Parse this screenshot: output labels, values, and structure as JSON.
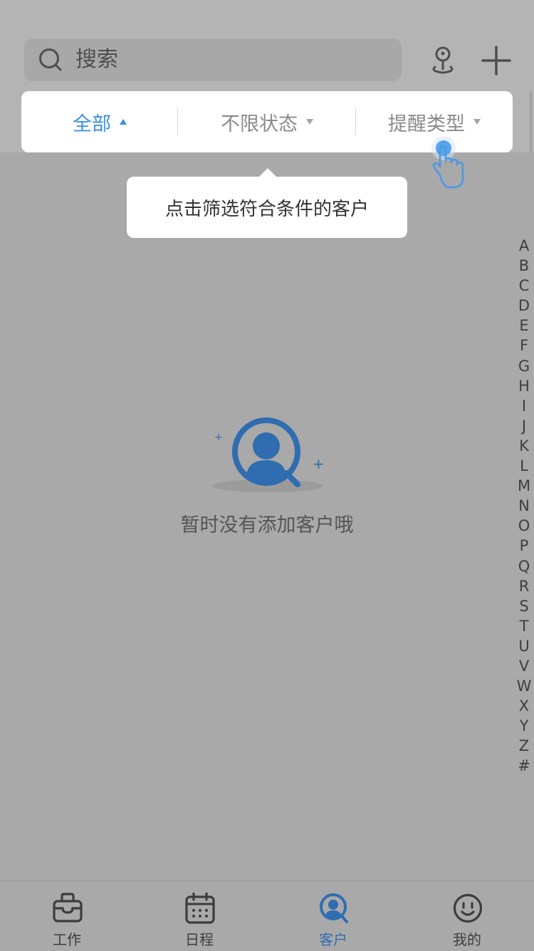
{
  "search": {
    "placeholder": "搜索"
  },
  "filters": [
    {
      "label": "全部",
      "active": true
    },
    {
      "label": "不限状态",
      "active": false
    },
    {
      "label": "提醒类型",
      "active": false
    }
  ],
  "tooltip": {
    "text": "点击筛选符合条件的客户"
  },
  "alphabet_index": [
    "A",
    "B",
    "C",
    "D",
    "E",
    "F",
    "G",
    "H",
    "I",
    "J",
    "K",
    "L",
    "M",
    "N",
    "O",
    "P",
    "Q",
    "R",
    "S",
    "T",
    "U",
    "V",
    "W",
    "X",
    "Y",
    "Z",
    "#"
  ],
  "empty_state": {
    "message": "暂时没有添加客户哦"
  },
  "tabs": [
    {
      "label": "工作",
      "icon": "briefcase-icon"
    },
    {
      "label": "日程",
      "icon": "calendar-icon"
    },
    {
      "label": "客户",
      "icon": "customer-icon",
      "active": true
    },
    {
      "label": "我的",
      "icon": "smiley-icon"
    }
  ],
  "colors": {
    "accent": "#3a8fe4",
    "active_tab": "#2f6db0",
    "overlay_bg": "#a9a9a9"
  }
}
